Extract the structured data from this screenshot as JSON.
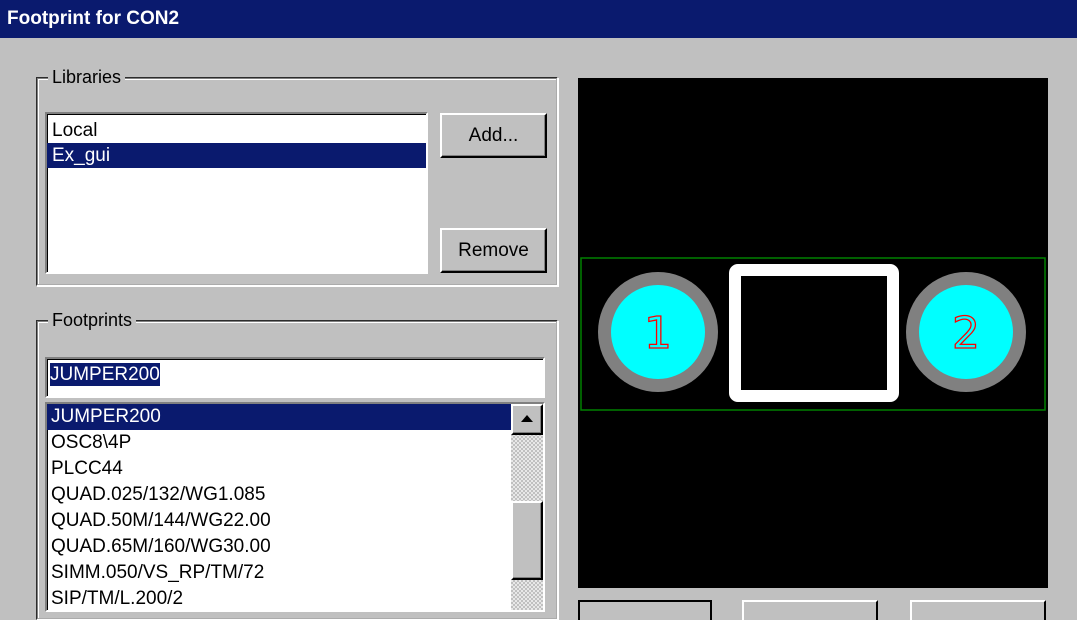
{
  "window": {
    "title": "Footprint for CON2"
  },
  "libraries": {
    "label": "Libraries",
    "items": [
      {
        "label": "Local",
        "selected": false
      },
      {
        "label": "Ex_gui",
        "selected": true
      }
    ],
    "add_button": "Add...",
    "remove_button": "Remove"
  },
  "footprints": {
    "label": "Footprints",
    "filter_value": "JUMPER200",
    "items": [
      {
        "label": "JUMPER200",
        "selected": true
      },
      {
        "label": "OSC8\\4P",
        "selected": false
      },
      {
        "label": "PLCC44",
        "selected": false
      },
      {
        "label": "QUAD.025/132/WG1.085",
        "selected": false
      },
      {
        "label": "QUAD.50M/144/WG22.00",
        "selected": false
      },
      {
        "label": "QUAD.65M/160/WG30.00",
        "selected": false
      },
      {
        "label": "SIMM.050/VS_RP/TM/72",
        "selected": false
      },
      {
        "label": "SIP/TM/L.200/2",
        "selected": false
      }
    ]
  },
  "preview": {
    "pads": [
      {
        "label": "1"
      },
      {
        "label": "2"
      }
    ],
    "colors": {
      "background": "#000000",
      "outline": "#008000",
      "pad_ring": "#808080",
      "pad_fill": "#00ffff",
      "pad_label": "#ff0000",
      "body": "#ffffff"
    }
  },
  "colors": {
    "titlebar": "#0a1a6e",
    "selection": "#0a1a6e",
    "face": "#c0c0c0"
  }
}
